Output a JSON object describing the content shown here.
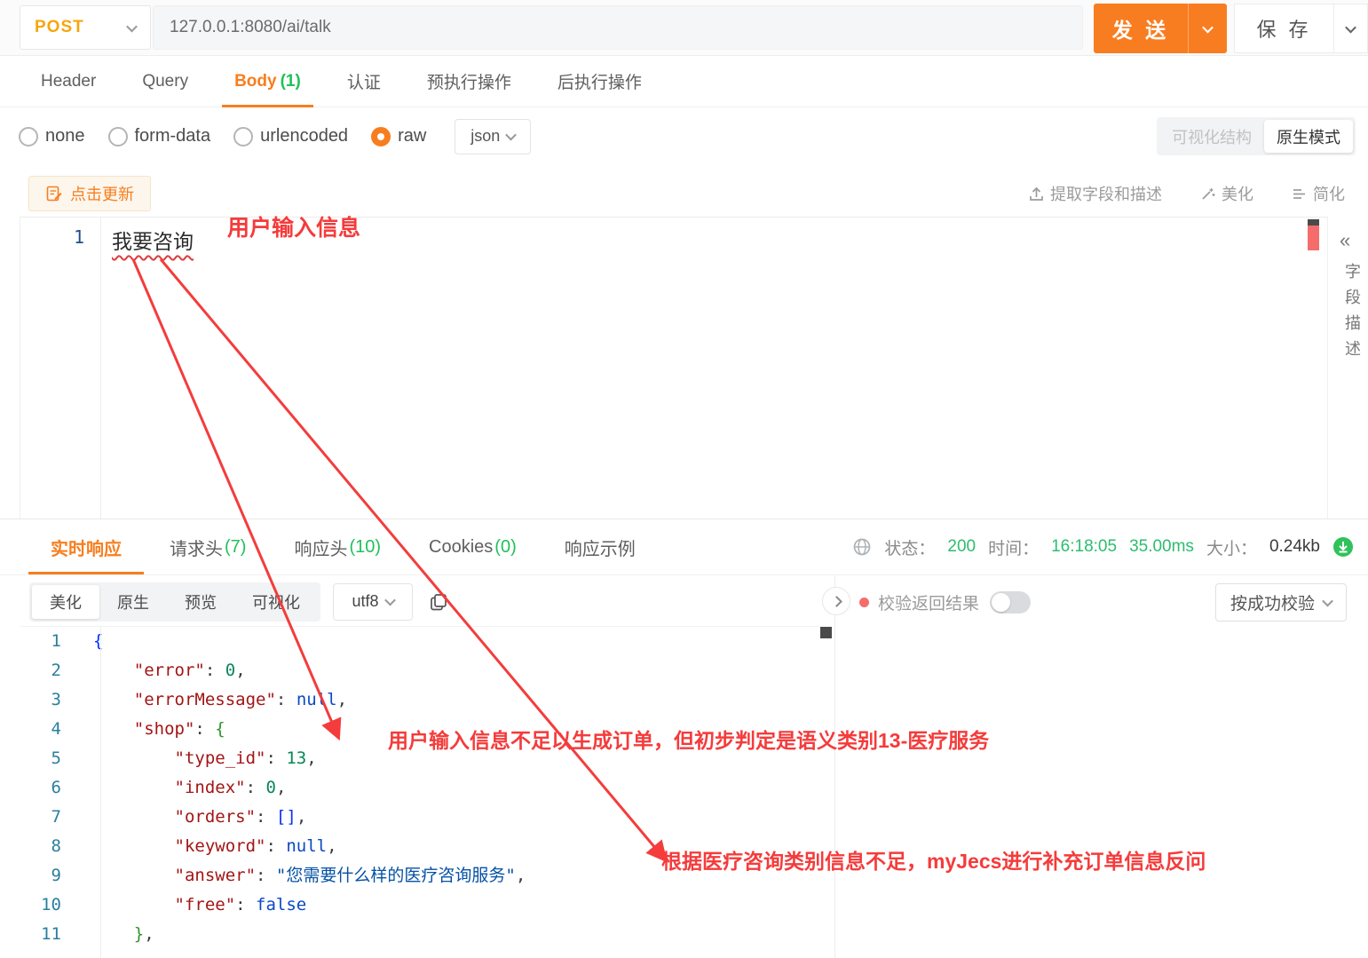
{
  "topbar": {
    "method": "POST",
    "url": "127.0.0.1:8080/ai/talk",
    "send": "发 送",
    "save": "保 存"
  },
  "request_tabs": [
    {
      "label": "Header"
    },
    {
      "label": "Query"
    },
    {
      "label": "Body",
      "count": "(1)",
      "active": true
    },
    {
      "label": "认证"
    },
    {
      "label": "预执行操作"
    },
    {
      "label": "后执行操作"
    }
  ],
  "body_type": {
    "options": [
      {
        "label": "none"
      },
      {
        "label": "form-data"
      },
      {
        "label": "urlencoded"
      },
      {
        "label": "raw",
        "selected": true
      }
    ],
    "format": "json",
    "view_left": "可视化结构",
    "view_right": "原生模式"
  },
  "editor": {
    "update_button": "点击更新",
    "extract": "提取字段和描述",
    "beautify": "美化",
    "simplify": "简化",
    "line_number": "1",
    "content": "我要咨询",
    "panel_collapse": "«",
    "panel_title": "字段描述"
  },
  "annotations": {
    "input": "用户输入信息",
    "shop": "用户输入信息不足以生成订单，但初步判定是语义类别13-医疗服务",
    "answer": "根据医疗咨询类别信息不足，myJecs进行补充订单信息反问"
  },
  "response": {
    "tabs": [
      {
        "label": "实时响应",
        "active": true
      },
      {
        "label": "请求头",
        "count": "(7)"
      },
      {
        "label": "响应头",
        "count": "(10)"
      },
      {
        "label": "Cookies",
        "count": "(0)"
      },
      {
        "label": "响应示例"
      }
    ],
    "meta": {
      "status_label": "状态：",
      "status": "200",
      "time_label": "时间：",
      "time": "16:18:05",
      "duration": "35.00ms",
      "size_label": "大小：",
      "size": "0.24kb"
    },
    "toolbar": {
      "modes": [
        {
          "label": "美化",
          "selected": true
        },
        {
          "label": "原生"
        },
        {
          "label": "预览"
        },
        {
          "label": "可视化"
        }
      ],
      "encoding": "utf8",
      "validate_label": "校验返回结果",
      "validate_mode": "按成功校验"
    },
    "code": {
      "lines": [
        {
          "n": "1",
          "segs": [
            [
              "b1",
              "{"
            ]
          ]
        },
        {
          "n": "2",
          "segs": [
            [
              "sp",
              "    "
            ],
            [
              "k",
              "\"error\""
            ],
            [
              "p",
              ": "
            ],
            [
              "num",
              "0"
            ],
            [
              "p",
              ","
            ]
          ]
        },
        {
          "n": "3",
          "segs": [
            [
              "sp",
              "    "
            ],
            [
              "k",
              "\"errorMessage\""
            ],
            [
              "p",
              ": "
            ],
            [
              "kw",
              "null"
            ],
            [
              "p",
              ","
            ]
          ]
        },
        {
          "n": "4",
          "segs": [
            [
              "sp",
              "    "
            ],
            [
              "k",
              "\"shop\""
            ],
            [
              "p",
              ": "
            ],
            [
              "b2",
              "{"
            ]
          ]
        },
        {
          "n": "5",
          "segs": [
            [
              "sp",
              "        "
            ],
            [
              "k",
              "\"type_id\""
            ],
            [
              "p",
              ": "
            ],
            [
              "num",
              "13"
            ],
            [
              "p",
              ","
            ]
          ]
        },
        {
          "n": "6",
          "segs": [
            [
              "sp",
              "        "
            ],
            [
              "k",
              "\"index\""
            ],
            [
              "p",
              ": "
            ],
            [
              "num",
              "0"
            ],
            [
              "p",
              ","
            ]
          ]
        },
        {
          "n": "7",
          "segs": [
            [
              "sp",
              "        "
            ],
            [
              "k",
              "\"orders\""
            ],
            [
              "p",
              ": "
            ],
            [
              "b1",
              "[]"
            ],
            [
              "p",
              ","
            ]
          ]
        },
        {
          "n": "8",
          "segs": [
            [
              "sp",
              "        "
            ],
            [
              "k",
              "\"keyword\""
            ],
            [
              "p",
              ": "
            ],
            [
              "kw",
              "null"
            ],
            [
              "p",
              ","
            ]
          ]
        },
        {
          "n": "9",
          "segs": [
            [
              "sp",
              "        "
            ],
            [
              "k",
              "\"answer\""
            ],
            [
              "p",
              ": "
            ],
            [
              "s",
              "\"您需要什么样的医疗咨询服务\""
            ],
            [
              "p",
              ","
            ]
          ]
        },
        {
          "n": "10",
          "segs": [
            [
              "sp",
              "        "
            ],
            [
              "k",
              "\"free\""
            ],
            [
              "p",
              ": "
            ],
            [
              "kw",
              "false"
            ]
          ]
        },
        {
          "n": "11",
          "segs": [
            [
              "sp",
              "    "
            ],
            [
              "b2",
              "}"
            ],
            [
              "p",
              ","
            ]
          ]
        }
      ]
    }
  }
}
